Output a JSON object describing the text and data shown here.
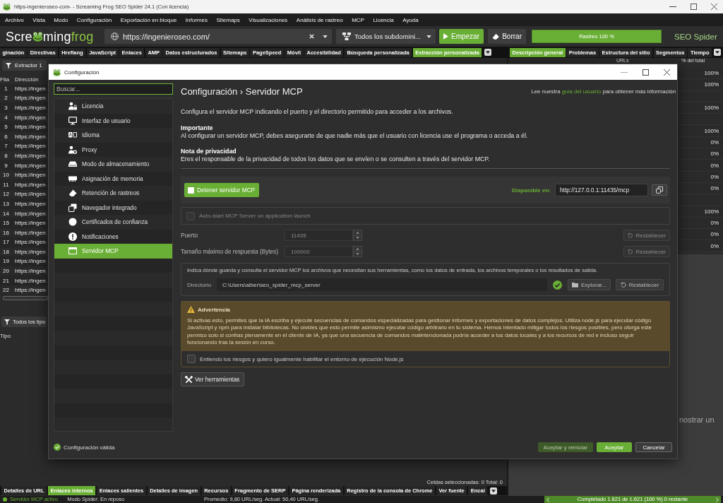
{
  "window": {
    "title": "https-ingenieroseo-com- - Screaming Frog SEO Spider 24.1 (Con licencia)"
  },
  "menu": [
    "Archivo",
    "Vista",
    "Modo",
    "Configuración",
    "Exportación en bloque",
    "Informes",
    "Sitemaps",
    "Visualizaciones",
    "Análisis de rastreo",
    "MCP",
    "Licencia",
    "Ayuda"
  ],
  "toolbar": {
    "logo": [
      "Scre",
      "ming",
      "frog"
    ],
    "url": "https://ingenieroseo.com/",
    "scope": "Todos los subdomini...",
    "start_button": "Empezar",
    "clear_button": "Borrar",
    "progress": {
      "label": "Rastreo 100 %",
      "level": 1
    },
    "product": "SEO Spider"
  },
  "top_tabs": {
    "left": [
      {
        "label": "ginación",
        "selected": false
      },
      {
        "label": "Directivas",
        "selected": false
      },
      {
        "label": "Hreflang",
        "selected": false
      },
      {
        "label": "JavaScript",
        "selected": false
      },
      {
        "label": "Enlaces",
        "selected": false
      },
      {
        "label": "AMP",
        "selected": false
      },
      {
        "label": "Datos estructurados",
        "selected": false
      },
      {
        "label": "Sitemaps",
        "selected": false
      },
      {
        "label": "PageSpeed",
        "selected": false
      },
      {
        "label": "Móvil",
        "selected": false
      },
      {
        "label": "Accesibilidad",
        "selected": false
      },
      {
        "label": "Búsqueda personalizada",
        "selected": false
      },
      {
        "label": "Extracción personalizada",
        "selected": true
      }
    ],
    "right": [
      {
        "label": "Descripción general",
        "selected": true
      },
      {
        "label": "Problemas",
        "selected": false
      },
      {
        "label": "Estructura del sitio",
        "selected": false
      },
      {
        "label": "Segmentos",
        "selected": false
      },
      {
        "label": "Tiempo",
        "selected": false
      }
    ]
  },
  "left_panel": {
    "filter_button": "Extractor 1",
    "columns": [
      "Fila",
      "Dirección"
    ],
    "rows": [
      {
        "number": "1",
        "address": "https://ingen"
      },
      {
        "number": "2",
        "address": "https://ingen"
      },
      {
        "number": "3",
        "address": "https://ingen"
      },
      {
        "number": "4",
        "address": "https://ingen"
      },
      {
        "number": "5",
        "address": "https://ingen"
      },
      {
        "number": "6",
        "address": "https://ingen"
      },
      {
        "number": "7",
        "address": "https://ingen"
      },
      {
        "number": "8",
        "address": "https://ingen"
      },
      {
        "number": "9",
        "address": "https://ingen"
      },
      {
        "number": "10",
        "address": "https://ingen"
      },
      {
        "number": "11",
        "address": "https://ingen"
      },
      {
        "number": "12",
        "address": "https://ingen"
      },
      {
        "number": "13",
        "address": "https://ingen"
      },
      {
        "number": "14",
        "address": "https://ingen"
      },
      {
        "number": "15",
        "address": "https://ingen"
      },
      {
        "number": "16",
        "address": "https://ingen"
      },
      {
        "number": "17",
        "address": "https://ingen"
      },
      {
        "number": "18",
        "address": "https://ingen"
      },
      {
        "number": "19",
        "address": "https://ingen"
      },
      {
        "number": "20",
        "address": "https://ingen"
      },
      {
        "number": "21",
        "address": "https://ingen"
      },
      {
        "number": "22",
        "address": "https://ingen"
      }
    ],
    "type_filter_button": "Todos los tipo",
    "type_column": "Tipo",
    "selection_summary": "Celdas seleccionadas: 0 Total: 0"
  },
  "right_panel": {
    "columns": [
      "URLs",
      "% del total"
    ],
    "rows": [
      {
        "share": "100%"
      },
      {
        "share": "100%"
      },
      {},
      {
        "share": "100%"
      },
      {},
      {
        "share": "100%"
      },
      {
        "share": "0%"
      },
      {
        "share": "0%"
      },
      {
        "share": "0%"
      },
      {
        "share": "0%"
      },
      {
        "share": "0%"
      },
      {},
      {
        "share": "100%"
      },
      {
        "share": "0%"
      },
      {
        "share": "0%"
      },
      {
        "share": "0%"
      }
    ],
    "message": "nostrar un"
  },
  "dialog": {
    "title": "Configuración",
    "search": {
      "placeholder": "Buscar..."
    },
    "nav": [
      {
        "label": "Licencia",
        "selected": false
      },
      {
        "label": "Interfaz de usuario",
        "selected": false
      },
      {
        "label": "Idioma",
        "selected": false
      },
      {
        "label": "Proxy",
        "selected": false
      },
      {
        "label": "Modo de almacenamiento",
        "selected": false
      },
      {
        "label": "Asignación de memoria",
        "selected": false
      },
      {
        "label": "Retención de rastreos",
        "selected": false
      },
      {
        "label": "Navegador integrado",
        "selected": false
      },
      {
        "label": "Certificados de confianza",
        "selected": false
      },
      {
        "label": "Notificaciones",
        "selected": false
      },
      {
        "label": "Servidor MCP",
        "selected": true
      }
    ],
    "heading": "Configuración › Servidor MCP",
    "help": {
      "before": "Lee nuestra",
      "link": "guía del usuario",
      "after": "para obtener más información"
    },
    "intro": "Configura el servidor MCP indicando el puerto y el directorio permitido para acceder a los archivos.",
    "notes": [
      {
        "title": "Importante",
        "text": "Al configurar un servidor MCP, debes asegurarte de que nadie más que el usuario con licencia use el programa o acceda a él."
      },
      {
        "title": "Nota de privacidad",
        "text": "Eres el responsable de la privacidad de todos los datos que se envíen o se consulten a través del servidor MCP."
      }
    ],
    "server": {
      "button": "Detener servidor MCP",
      "address_label": "Disponible en:",
      "address": "http://127.0.0.1:11435/mcp"
    },
    "autostart": {
      "label": "Auto-start MCP Server on application launch",
      "checked": false,
      "disabled": true
    },
    "settings": [
      {
        "label": "Puerto",
        "value": "11435",
        "reset": "Restablecer",
        "disabled": true
      },
      {
        "label": "Tamaño máximo de respuesta (Bytes)",
        "value": "100000",
        "reset": "Restablecer",
        "disabled": true
      }
    ],
    "directory": {
      "description": "Indica dónde guarda y consulta el servidor MCP los archivos que necesitan sus herramientas, como los datos de entrada, los archivos temporales o los resultados de salida.",
      "label": "Directorio",
      "value": "C:\\Users\\alber\\seo_spider_mcp_server",
      "valid": true,
      "browse": "Explorar...",
      "reset": "Restablecer"
    },
    "warning": {
      "title": "Advertencia",
      "text": "Si activas esto, permites que la IA escriba y ejecute secuencias de comandos especializadas para gestionar informes y exportaciones de datos complejos. Utiliza node.js para ejecutar código JavaScript y npm para instalar bibliotecas. No olvides que esto permite asimismo ejecutar código arbitrario en tu sistema. Hemos intentado mitigar todos los riesgos posibles, pero otorga este permiso solo si confías plenamente en el cliente de IA, ya que una secuencia de comandos malintencionada podría acceder a tus datos locales y a los recursos de red e incluso seguir funcionando tras la sesión en curso.",
      "consent": {
        "label": "Entiendo los riesgos y quiero igualmente habilitar el entorno de ejecución Node.js",
        "checked": false
      }
    },
    "tools_button": "Ver herramientas",
    "status": {
      "label": "Configuración válida",
      "valid": true
    },
    "buttons": [
      {
        "label": "Aceptar y reiniciar",
        "kind": "restart",
        "disabled": true
      },
      {
        "label": "Aceptar",
        "kind": "primary",
        "disabled": false
      },
      {
        "label": "Cancelar",
        "kind": "secondary",
        "disabled": false
      }
    ]
  },
  "bottom_tabs": [
    {
      "label": "Detalles de URL",
      "selected": false
    },
    {
      "label": "Enlaces internos",
      "selected": true
    },
    {
      "label": "Enlaces salientes",
      "selected": false
    },
    {
      "label": "Detalles de imagen",
      "selected": false
    },
    {
      "label": "Recursos",
      "selected": false
    },
    {
      "label": "Fragmento de SERP",
      "selected": false
    },
    {
      "label": "Página renderizada",
      "selected": false
    },
    {
      "label": "Registro de la consola de Chrome",
      "selected": false
    },
    {
      "label": "Ver fuente",
      "selected": false
    },
    {
      "label": "Encal",
      "selected": false
    }
  ],
  "status_bar": {
    "server": "Servidor MCP activo",
    "mode": "Modo Spider: En reposo",
    "speed": "Promedio: 9,80 URL/seg. Actual: 50,40 URL/seg.",
    "progress": {
      "label": "Completado 1.621 de 1.621 (100 %) 0 restante",
      "level": 1
    }
  }
}
